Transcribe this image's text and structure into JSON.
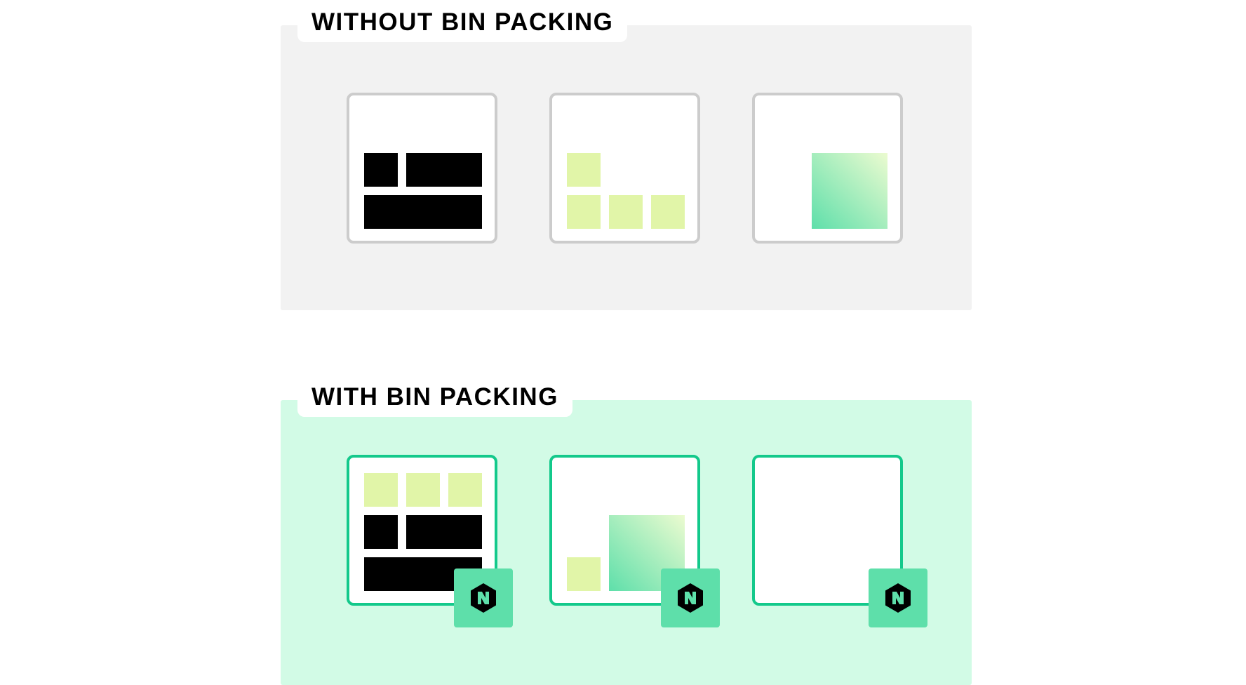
{
  "panels": {
    "top": {
      "label": "WITHOUT BIN PACKING"
    },
    "bottom": {
      "label": "WITH BIN PACKING"
    }
  },
  "colors": {
    "top_panel_bg": "#f2f2f2",
    "bottom_panel_bg": "#d2fbe6",
    "node_border_gray": "#cccccc",
    "node_border_green": "#13c98b",
    "block_black": "#000000",
    "block_lime": "#e1f5a8",
    "block_gradient_from": "#5edfaa",
    "block_gradient_to": "#ecfbd0",
    "badge_bg": "#5edfaa",
    "badge_hex": "#000000",
    "badge_glyph": "#5edfaa"
  },
  "icons": {
    "badge": "nomad-logo-icon"
  }
}
